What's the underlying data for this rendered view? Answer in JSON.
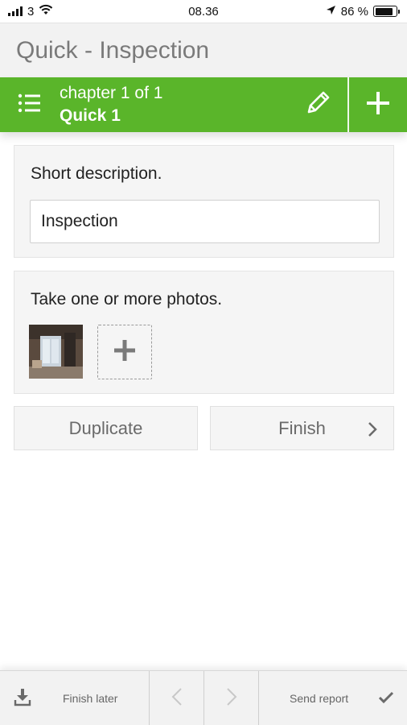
{
  "status_bar": {
    "carrier": "3",
    "time": "08.36",
    "battery_percent": "86 %",
    "battery_level": 0.86
  },
  "header": {
    "title": "Quick - Inspection"
  },
  "chapter_bar": {
    "subtitle": "chapter 1 of 1",
    "name": "Quick 1",
    "accent_color": "#5ab52a"
  },
  "description_card": {
    "label": "Short description.",
    "input_value": "Inspection"
  },
  "photos_card": {
    "label": "Take one or more photos."
  },
  "actions": {
    "duplicate_label": "Duplicate",
    "finish_label": "Finish"
  },
  "bottom_bar": {
    "finish_later_label": "Finish later",
    "send_report_label": "Send report"
  },
  "icons": [
    "signal-icon",
    "wifi-icon",
    "location-arrow-icon",
    "battery-icon",
    "list-icon",
    "pencil-icon",
    "plus-icon",
    "chevron-right-icon",
    "download-icon",
    "chevron-left-icon",
    "checkmark-icon"
  ]
}
